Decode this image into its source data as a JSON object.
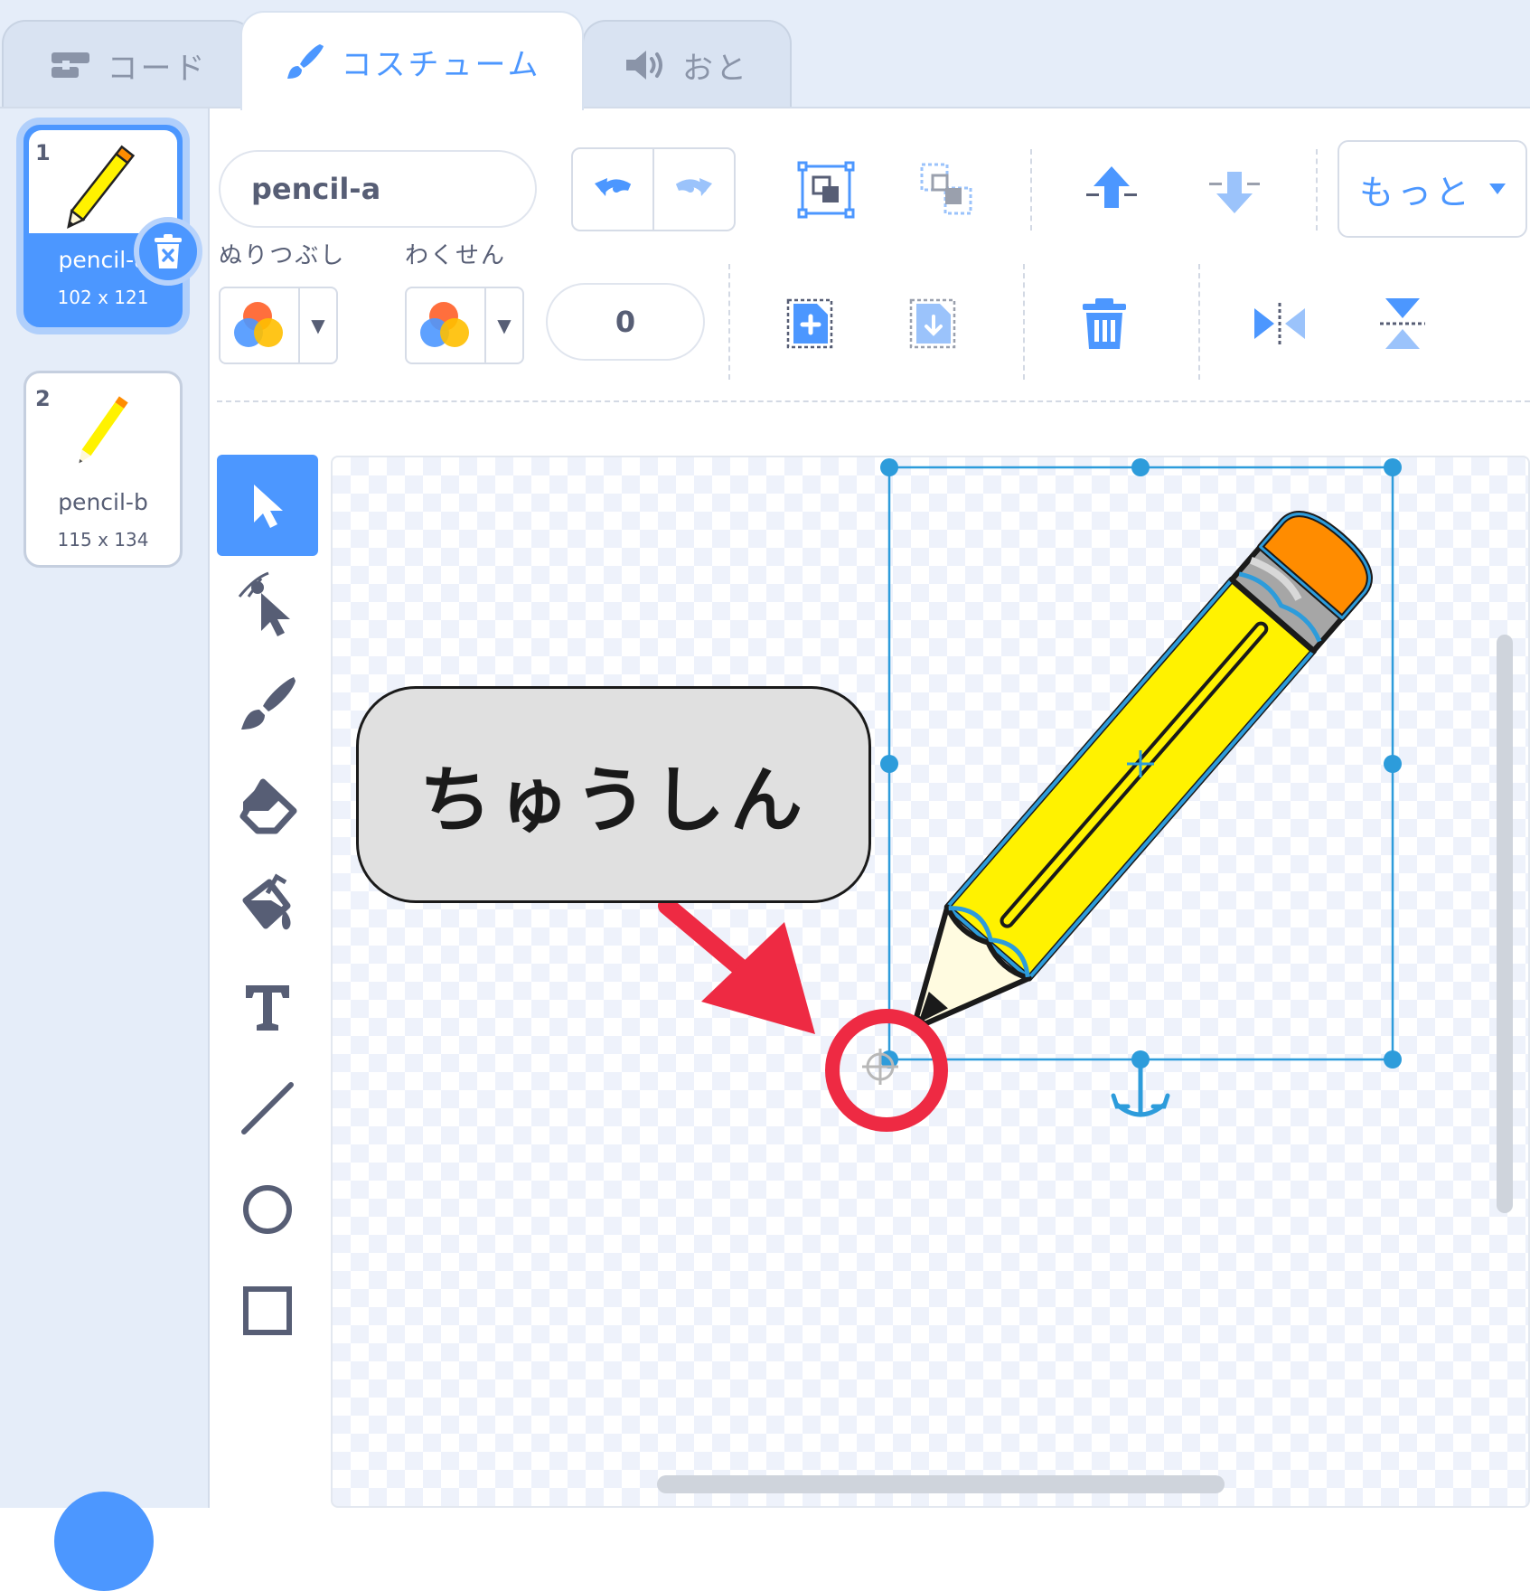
{
  "tabs": {
    "code": "コード",
    "costume": "コスチューム",
    "sound": "おと"
  },
  "costumes": [
    {
      "number": "1",
      "name": "pencil-a",
      "size": "102 x 121"
    },
    {
      "number": "2",
      "name": "pencil-b",
      "size": "115 x 134"
    }
  ],
  "toolbar": {
    "costume_name": "pencil-a",
    "fill_label": "ぬりつぶし",
    "outline_label": "わくせん",
    "outline_width": "0",
    "more_label": "もっと"
  },
  "callout": {
    "text": "ちゅうしん"
  },
  "colors": {
    "accent": "#4c97ff",
    "tab_bar": "#e5edf9",
    "pencil_body": "#fff200",
    "pencil_eraser": "#ff8c00",
    "selection": "#2d9cdb",
    "marker": "#ee2a43"
  },
  "icons": {
    "code_tab": "code-blocks-icon",
    "costume_tab": "paintbrush-icon",
    "sound_tab": "speaker-icon",
    "delete": "trash-icon",
    "undo": "undo-icon",
    "redo": "redo-icon",
    "group": "group-icon",
    "ungroup": "ungroup-icon",
    "forward": "arrow-up-icon",
    "backward": "arrow-down-icon",
    "copy": "copy-icon",
    "paste": "paste-icon",
    "flip_horizontal": "flip-horizontal-icon",
    "flip_vertical": "flip-vertical-icon",
    "tools": [
      "select-icon",
      "reshape-icon",
      "brush-icon",
      "eraser-icon",
      "fill-icon",
      "text-icon",
      "line-icon",
      "circle-icon",
      "rectangle-icon"
    ]
  }
}
